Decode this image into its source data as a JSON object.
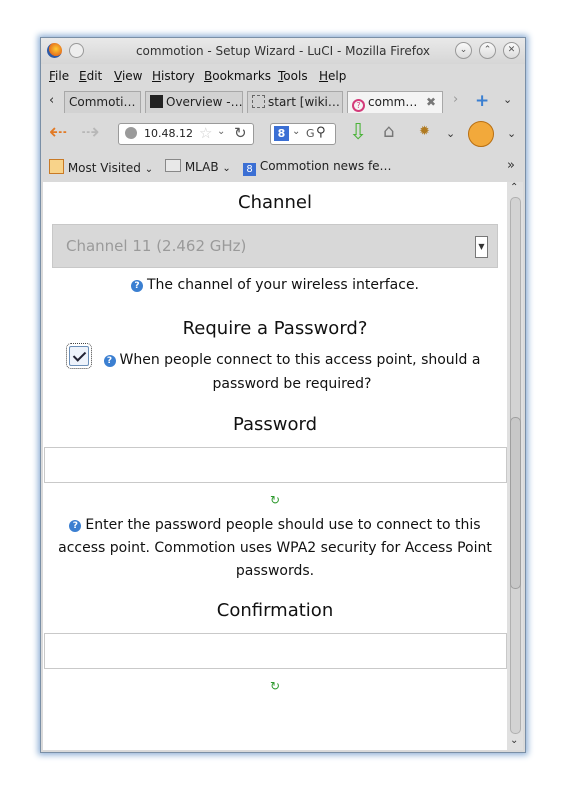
{
  "window": {
    "title": "commotion - Setup Wizard - LuCI - Mozilla Firefox"
  },
  "menu": [
    "File",
    "Edit",
    "View",
    "History",
    "Bookmarks",
    "Tools",
    "Help"
  ],
  "tabs": [
    {
      "label": "Commoti…"
    },
    {
      "label": "Overview -…"
    },
    {
      "label": "start [wiki…"
    },
    {
      "label": "comm…"
    }
  ],
  "toolbar": {
    "url": "10.48.12",
    "search_engine_letter": "8",
    "search_glyph": "G"
  },
  "bookmarks": [
    "Most Visited",
    "MLAB",
    "Commotion news fe…"
  ],
  "page": {
    "channel_heading": "Channel",
    "channel_value": "Channel 11 (2.462 GHz)",
    "channel_help": "The channel of your wireless interface.",
    "password_required_heading": "Require a Password?",
    "password_required_checked": true,
    "password_required_help_line1": "When people connect to this access point, should a",
    "password_required_help_line2": "password be required?",
    "password_heading": "Password",
    "password_help_line1": "Enter the password people should use to connect to this",
    "password_help_line2": "access point. Commotion uses WPA2 security for Access Point",
    "password_help_line3": "passwords.",
    "confirmation_heading": "Confirmation"
  }
}
